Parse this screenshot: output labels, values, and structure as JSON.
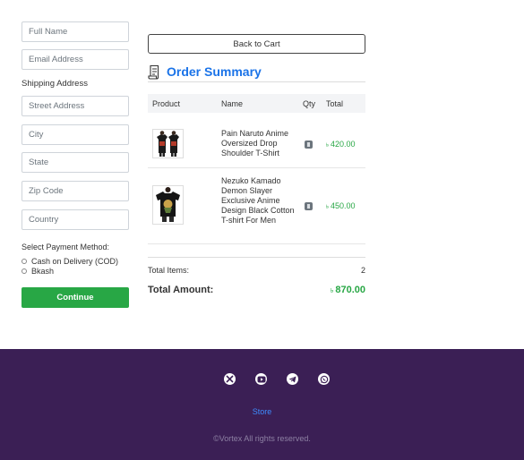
{
  "form": {
    "full_name": {
      "placeholder": "Full Name",
      "value": ""
    },
    "email": {
      "placeholder": "Email Address",
      "value": ""
    },
    "shipping_label": "Shipping Address",
    "street": {
      "placeholder": "Street Address",
      "value": ""
    },
    "city": {
      "placeholder": "City",
      "value": ""
    },
    "state": {
      "placeholder": "State",
      "value": ""
    },
    "zip": {
      "placeholder": "Zip Code",
      "value": ""
    },
    "country": {
      "placeholder": "Country",
      "value": ""
    },
    "payment_label": "Select Payment Method:",
    "payment_options": [
      "Cash on Delivery (COD)",
      "Bkash"
    ],
    "continue_label": "Continue"
  },
  "order": {
    "back_label": "Back to Cart",
    "title": "Order Summary",
    "columns": [
      "Product",
      "Name",
      "Qty",
      "Total"
    ],
    "items": [
      {
        "name": "Pain Naruto Anime Oversized Drop Shoulder T-Shirt",
        "currency": "৳",
        "total": "420.00"
      },
      {
        "name": "Nezuko Kamado Demon Slayer Exclusive Anime Design Black Cotton T-shirt For Men",
        "currency": "৳",
        "total": "450.00"
      }
    ],
    "total_items_label": "Total Items:",
    "total_items": "2",
    "total_amount_label": "Total Amount:",
    "total_currency": "৳",
    "total_amount": "870.00"
  },
  "footer": {
    "social_icons": [
      "x-icon",
      "youtube-icon",
      "telegram-icon",
      "whatsapp-icon"
    ],
    "link": "Store",
    "copyright": "©Vortex All rights reserved."
  },
  "colors": {
    "accent_blue": "#1a73e8",
    "success_green": "#28a745",
    "footer_bg": "#3b1f55"
  }
}
